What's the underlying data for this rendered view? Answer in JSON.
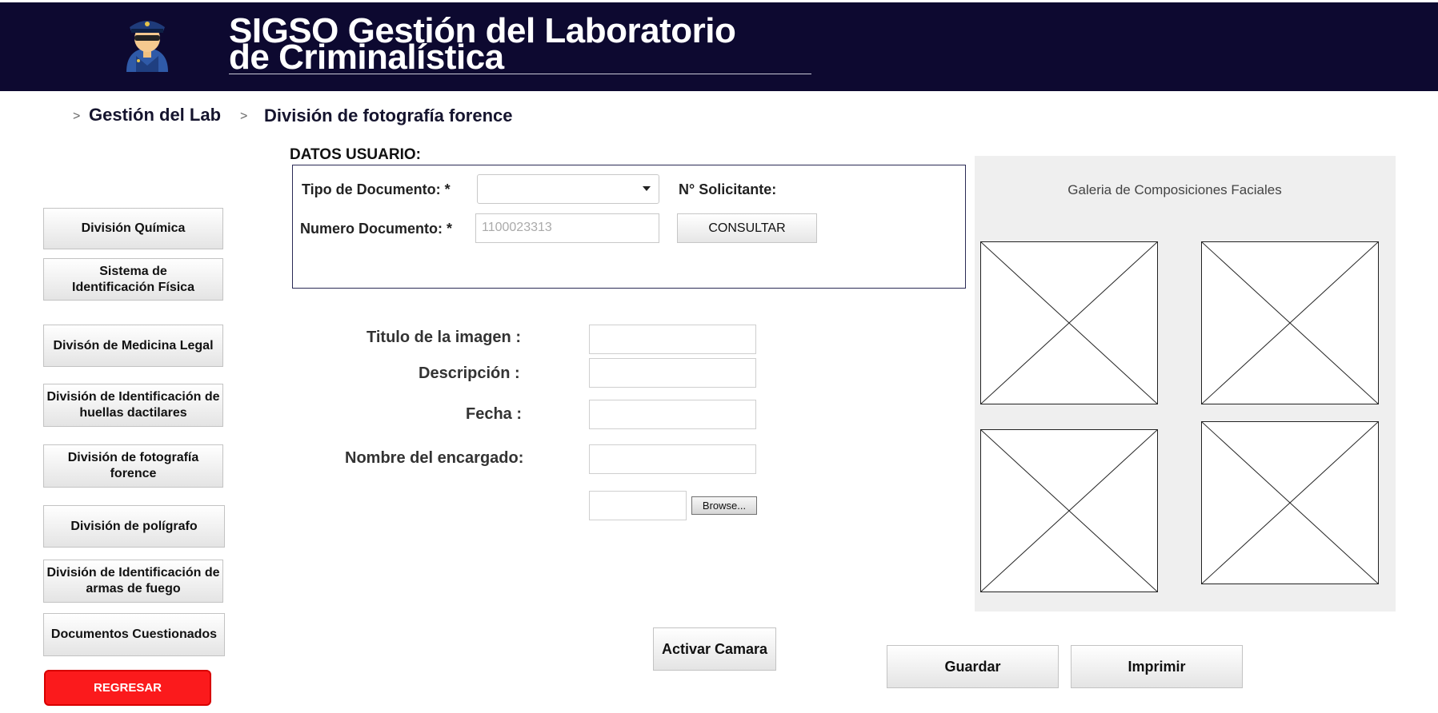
{
  "header": {
    "title_line1": "SIGSO  Gestión del Laboratorio",
    "title_line2": "de Criminalística",
    "logo_icon": "police-officer-icon",
    "background_color": "#0d0930"
  },
  "breadcrumb": {
    "separator": ">",
    "items": [
      "Gestión del Lab",
      "División de fotografía forence"
    ]
  },
  "sidebar": {
    "items": [
      {
        "label": "División Química"
      },
      {
        "label": "Sistema de Identificación Física"
      },
      {
        "label": "Divisón de Medicina Legal"
      },
      {
        "label": "División de Identificación de huellas dactilares"
      },
      {
        "label": "División de fotografía forence"
      },
      {
        "label": "División de polígrafo"
      },
      {
        "label": "División de Identificación de armas de fuego"
      },
      {
        "label": "Documentos Cuestionados"
      }
    ],
    "back_button": {
      "label": "REGRESAR",
      "color": "#fb1a1c"
    }
  },
  "datos_usuario": {
    "section_title": "DATOS USUARIO:",
    "tipo_documento_label": "Tipo de Documento: *",
    "tipo_documento_value": "",
    "numero_documento_label": "Numero Documento: *",
    "numero_documento_placeholder": "1100023313",
    "solicitante_label": "N° Solicitante:",
    "consultar_label": "CONSULTAR"
  },
  "form": {
    "titulo_label": "Titulo de la imagen :",
    "descripcion_label": "Descripción :",
    "fecha_label": "Fecha :",
    "encargado_label": "Nombre del encargado:",
    "browse_label": "Browse..."
  },
  "gallery": {
    "title": "Galeria de Composiciones Faciales",
    "placeholder_icon": "image-placeholder-icon"
  },
  "actions": {
    "camera_label": "Activar Camara",
    "save_label": "Guardar",
    "print_label": "Imprimir"
  }
}
